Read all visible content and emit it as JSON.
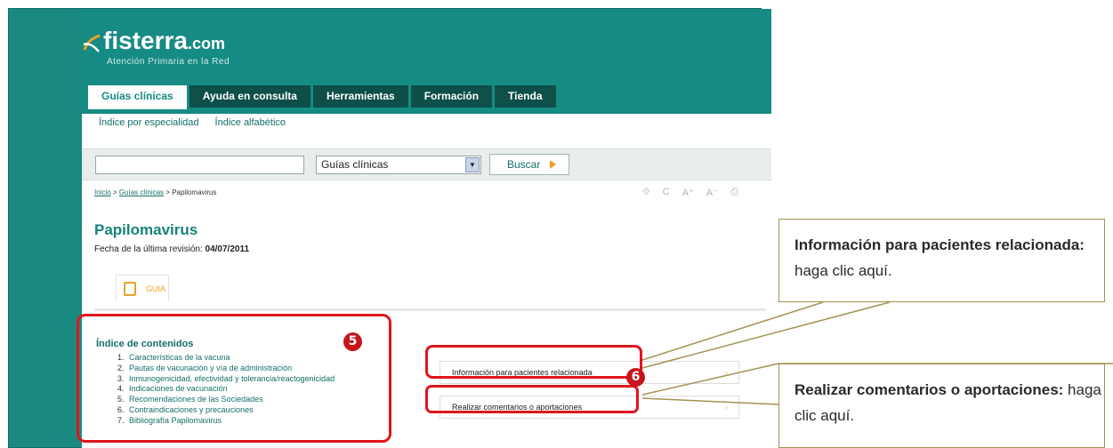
{
  "site": {
    "logo_text": "fisterra",
    "logo_domain": ".com",
    "tagline": "Atención Primaria en la Red"
  },
  "tabs": [
    {
      "label": "Guías clínicas",
      "active": true
    },
    {
      "label": "Ayuda en consulta",
      "active": false
    },
    {
      "label": "Herramientas",
      "active": false
    },
    {
      "label": "Formación",
      "active": false
    },
    {
      "label": "Tienda",
      "active": false
    }
  ],
  "subnav": {
    "items": [
      "Índice por especialidad",
      "Índice alfabético"
    ]
  },
  "search": {
    "input_value": "",
    "select_value": "Guías clínicas",
    "button_label": "Buscar"
  },
  "breadcrumb": {
    "home": "Inicio",
    "sep1": " > ",
    "section": "Guías clínicas",
    "sep2": " > ",
    "current": "Papilomavirus"
  },
  "tools": [
    "⟐",
    "C",
    "A⁺",
    "A⁻",
    "⎙"
  ],
  "page": {
    "title": "Papilomavirus",
    "revision_label": "Fecha de la última revisión:",
    "revision_date": "04/07/2011",
    "tab_label": "GUIA"
  },
  "toc": {
    "title": "Índice de contenidos",
    "items": [
      {
        "num": "1.",
        "label": "Características de la vacuna"
      },
      {
        "num": "2.",
        "label": "Pautas de vacunación y vía de administración"
      },
      {
        "num": "3.",
        "label": "Inmunogenicidad, efectividad y tolerancia/reactogenicidad"
      },
      {
        "num": "4.",
        "label": "Indicaciones de vacunación"
      },
      {
        "num": "5.",
        "label": "Recomendaciones de las Sociedades"
      },
      {
        "num": "6.",
        "label": "Contraindicaciones y precauciones"
      },
      {
        "num": "7.",
        "label": "Bibliografía Papilomavirus"
      }
    ]
  },
  "side_links": {
    "patients": "Información para pacientes relacionada",
    "comments": "Realizar comentarios o aportaciones"
  },
  "badges": {
    "five": "5",
    "six": "6"
  },
  "callouts": {
    "patients_bold": "Información para pacientes relacionada:",
    "patients_rest": " haga clic aquí.",
    "comments_bold": "Realizar comentarios o aportaciones:",
    "comments_rest": " haga clic aquí."
  },
  "colors": {
    "brand_teal": "#168b84",
    "tab_dark": "#0e4f4a",
    "highlight_red": "#e0141c",
    "callout_border": "#a39354",
    "accent_orange": "#f0a21f"
  }
}
